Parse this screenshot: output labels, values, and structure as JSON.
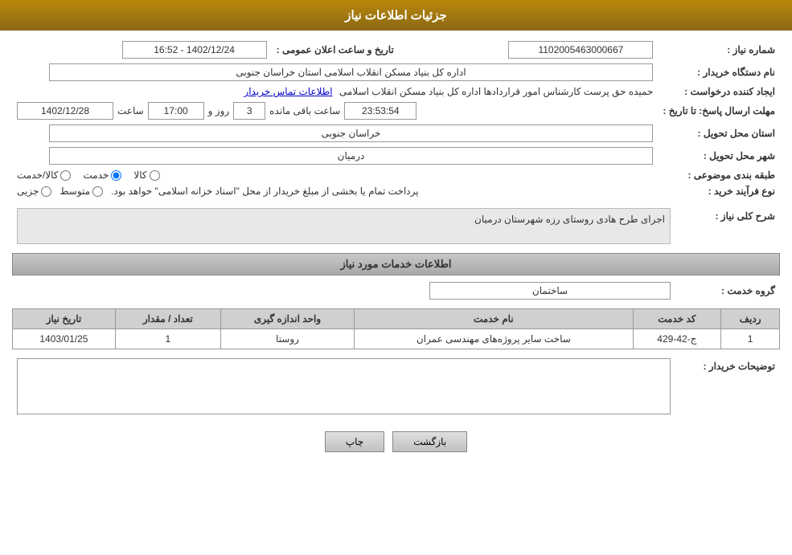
{
  "header": {
    "title": "جزئیات اطلاعات نیاز"
  },
  "fields": {
    "shomareNiaz_label": "شماره نیاز :",
    "shomareNiaz_value": "1102005463000667",
    "namDastgah_label": "نام دستگاه خریدار :",
    "namDastgah_value": "اداره کل بنیاد مسکن انقلاب اسلامی استان خراسان جنوبی",
    "ijadKonande_label": "ایجاد کننده درخواست :",
    "ijadKonande_value": "حمیده حق پرست کارشناس امور قراردادها اداره کل بنیاد مسکن انقلاب اسلامی",
    "etelaatTamas_label": "اطلاعات تماس خریدار",
    "tarikhErsal_label": "مهلت ارسال پاسخ: تا تاریخ :",
    "tarikhValue": "1402/12/28",
    "saatLabel": "ساعت",
    "saatValue": "17:00",
    "rozLabel": "روز و",
    "rozValue": "3",
    "saatBaghiLabel": "ساعت باقی مانده",
    "saatBaghiValue": "23:53:54",
    "tarikhElan_label": "تاریخ و ساعت اعلان عمومی :",
    "tarikhElan_value": "1402/12/24 - 16:52",
    "ostanTahvil_label": "استان محل تحویل :",
    "ostanTahvil_value": "خراسان جنوبی",
    "shahrTahvil_label": "شهر محل تحویل :",
    "shahrTahvil_value": "درمیان",
    "tabaqeBandi_label": "طبقه بندی موضوعی :",
    "tabaqe_kala": "کالا",
    "tabaqe_khedmat": "خدمت",
    "tabaqe_kala_khedmat": "کالا/خدمت",
    "naveFarayand_label": "نوع فرآیند خرید :",
    "naveFarayand_jozvi": "جزیی",
    "naveFarayand_motovaset": "متوسط",
    "naveFarayand_desc": "پرداخت تمام یا بخشی از مبلغ خریدار از محل \"اسناد خزانه اسلامی\" خواهد بود.",
    "sharhKoli_label": "شرح کلی نیاز :",
    "sharhKoli_value": "اجرای طرح هادی روستای رزه شهرستان درمیان",
    "etelaaatSection": "اطلاعات خدمات مورد نیاز",
    "groheKhedmat_label": "گروه خدمت :",
    "groheKhedmat_value": "ساختمان",
    "table": {
      "headers": [
        "ردیف",
        "کد خدمت",
        "نام خدمت",
        "واحد اندازه گیری",
        "تعداد / مقدار",
        "تاریخ نیاز"
      ],
      "rows": [
        [
          "1",
          "ج-42-429",
          "ساخت سایر پروژه‌های مهندسی عمران",
          "روستا",
          "1",
          "1403/01/25"
        ]
      ]
    },
    "tozihat_label": "توضیحات خریدار :",
    "tozihat_value": "",
    "btn_print": "چاپ",
    "btn_back": "بازگشت"
  }
}
